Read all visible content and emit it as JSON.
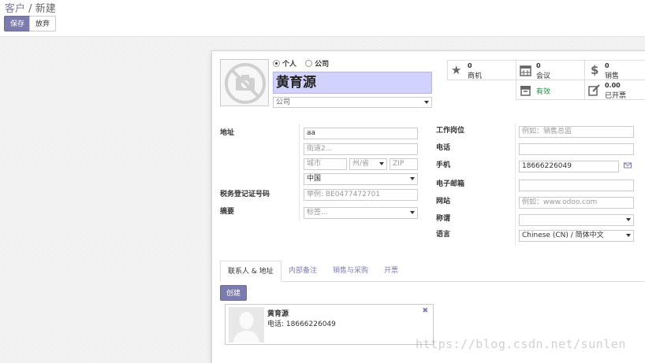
{
  "breadcrumb": {
    "parent": "客户",
    "separator": "/",
    "current": "新建"
  },
  "toolbar": {
    "save_label": "保存",
    "discard_label": "放弃"
  },
  "partner": {
    "type_options": [
      "个人",
      "公司"
    ],
    "type_selected": "个人",
    "name": "黄育源",
    "company_placeholder": "公司"
  },
  "smart_buttons": [
    {
      "icon": "star-icon",
      "count": "0",
      "label": "商机"
    },
    {
      "icon": "calendar-icon",
      "count": "0",
      "label": "会议"
    },
    {
      "icon": "dollar-icon",
      "count": "0",
      "label": "销售"
    },
    {
      "icon": "archive-icon",
      "count": "",
      "label": "有效"
    },
    {
      "icon": "edit-icon",
      "count": "0.00",
      "label": "已开票"
    }
  ],
  "address": {
    "label": "地址",
    "street": "aa",
    "street2_placeholder": "街道2...",
    "city_placeholder": "城市",
    "state_placeholder": "州/省",
    "zip_placeholder": "ZIP",
    "country": "中国"
  },
  "vat": {
    "label": "税务登记证号码",
    "placeholder": "举例: BE0477472701"
  },
  "tags": {
    "label": "摘要",
    "placeholder": "标签..."
  },
  "right_fields": {
    "function_label": "工作岗位",
    "function_placeholder": "例如：销售总监",
    "phone_label": "电话",
    "phone_value": "",
    "mobile_label": "手机",
    "mobile_value": "18666226049",
    "email_label": "电子邮箱",
    "email_value": "",
    "website_label": "网站",
    "website_placeholder": "例如：www.odoo.com",
    "title_label": "称谓",
    "title_value": "",
    "lang_label": "语言",
    "lang_value": "Chinese (CN) / 简体中文"
  },
  "tabs": [
    "联系人 & 地址",
    "内部备注",
    "销售与采购",
    "开票"
  ],
  "tab_active": "联系人 & 地址",
  "create_label": "创建",
  "contact_card": {
    "name": "黄育源",
    "phone": "电话: 18666226049",
    "close": "✖"
  },
  "watermark": "https://blog.csdn.net/sunlen",
  "colors": {
    "primary": "#7c7bad",
    "name_highlight": "#d2d2ff"
  }
}
